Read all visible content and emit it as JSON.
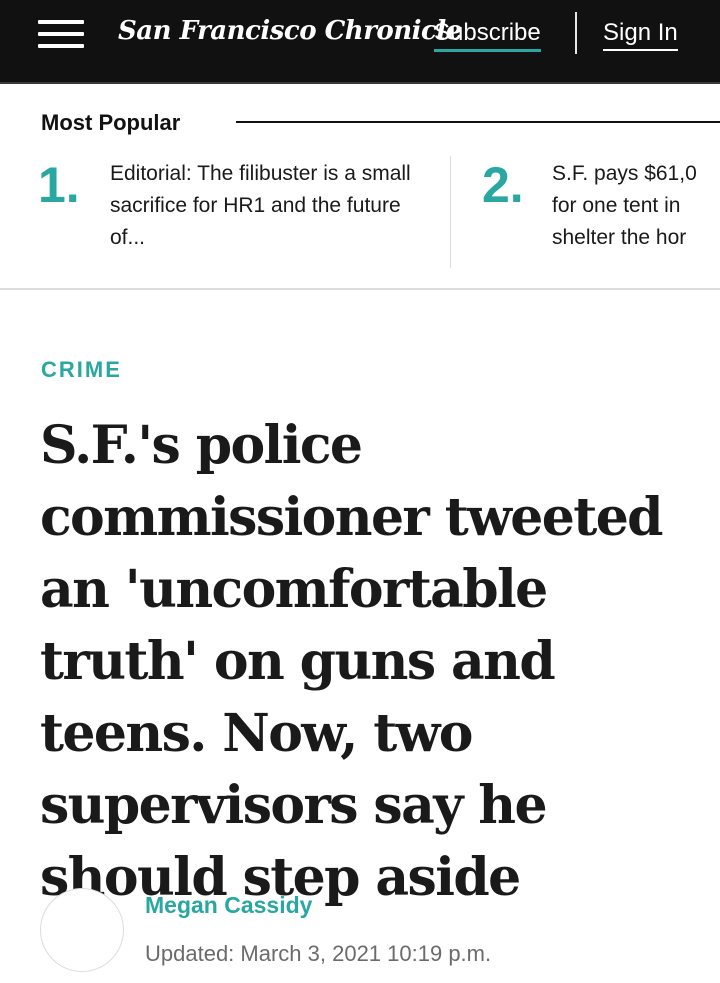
{
  "header": {
    "logo_text": "San Francisco Chronicle",
    "subscribe_label": "Subscribe",
    "signin_label": "Sign In"
  },
  "most_popular": {
    "title": "Most Popular",
    "items": [
      {
        "rank": "1.",
        "text": "Editorial: The filibuster is a small sacrifice for HR1 and the future of..."
      },
      {
        "rank": "2.",
        "text_lines": [
          "S.F. pays $61,0",
          "for one tent in",
          "shelter the hor"
        ]
      }
    ]
  },
  "article": {
    "section": "CRIME",
    "headline": "S.F.'s police commissioner tweeted an 'uncomfortable truth' on guns and teens. Now, two supervisors say he should step aside",
    "author": "Megan Cassidy",
    "updated": "Updated: March 3, 2021 10:19 p.m."
  },
  "colors": {
    "accent": "#2aa7a1",
    "header_bg": "#111111"
  }
}
